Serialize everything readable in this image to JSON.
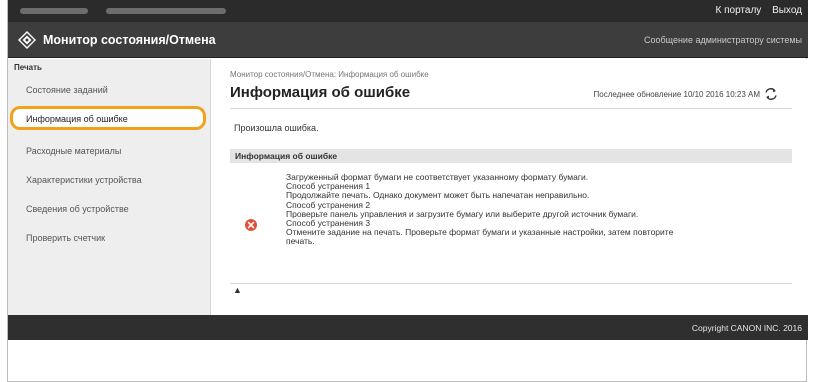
{
  "header": {
    "links": [
      "К порталу",
      "Выход"
    ],
    "app_title": "Монитор состояния/Отмена",
    "admin_message": "Сообщение администратору системы"
  },
  "sidebar": {
    "section": "Печать",
    "items": [
      {
        "label": "Состояние заданий"
      },
      {
        "label": "Информация об ошибке"
      },
      {
        "label": "Расходные материалы"
      },
      {
        "label": "Характеристики устройства"
      },
      {
        "label": "Сведения об устройстве"
      },
      {
        "label": "Проверить счетчик"
      }
    ]
  },
  "main": {
    "breadcrumb": "Монитор состояния/Отмена: Информация об ошибке",
    "title": "Информация об ошибке",
    "last_update": "Последнее обновление 10/10 2016 10:23 AM",
    "status_text": "Произошла ошибка.",
    "section_title": "Информация об ошибке",
    "detail_lines": [
      "Загруженный формат бумаги не соответствует указанному формату бумаги.",
      "Способ устранения 1",
      "Продолжайте печать. Однако документ может быть напечатан неправильно.",
      "Способ устранения 2",
      "Проверьте панель управления и загрузите бумагу или выберите другой источник бумаги.",
      "Способ устранения 3",
      "Отмените задание на печать. Проверьте формат бумаги и указанные настройки, затем повторите",
      "печать."
    ],
    "to_top": "▲"
  },
  "footer": {
    "copyright": "Copyright CANON INC. 2016"
  },
  "colors": {
    "highlight": "#f2a21a",
    "error": "#e0533b"
  }
}
